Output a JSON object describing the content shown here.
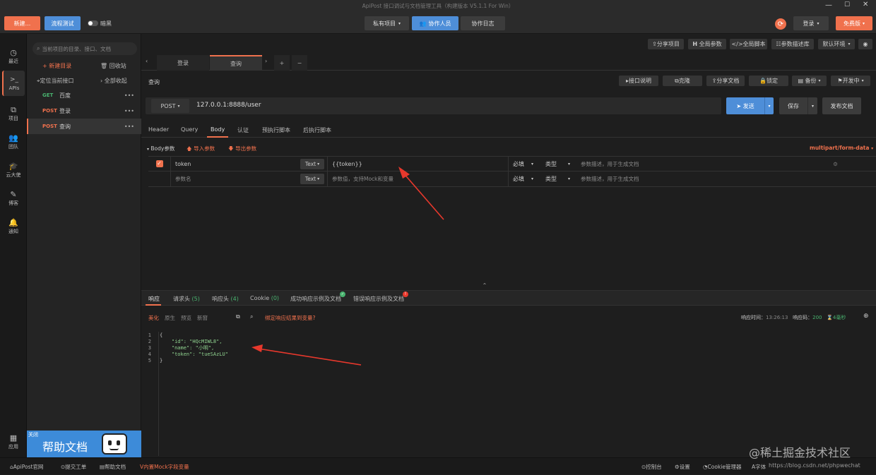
{
  "titlebar": {
    "title": "ApiPost 接口调试与文档管理工具（构建版本 V5.1.1 For Win）",
    "new_button": "新建...",
    "flow_test_button": "流程测试",
    "toggle_label": "暗黑",
    "private_project": "私有项目",
    "collaborators": "协作人员",
    "collab_log": "协作日志",
    "login": "登录",
    "free_version": "免费版"
  },
  "sidebar": {
    "items": [
      {
        "label": "最近",
        "icon": "clock-icon"
      },
      {
        "label": "APIs",
        "icon": "terminal-icon"
      },
      {
        "label": "项目",
        "icon": "project-icon"
      },
      {
        "label": "团队",
        "icon": "team-icon"
      },
      {
        "label": "云大使",
        "icon": "cap-icon"
      },
      {
        "label": "博客",
        "icon": "edit-icon"
      },
      {
        "label": "通知",
        "icon": "bell-icon"
      }
    ],
    "apps_label": "应用"
  },
  "tree": {
    "search_placeholder": "当前项目的目录、接口、文档",
    "new_dir": "新建目录",
    "recycle": "回收站",
    "locate": "定位当前接口",
    "collapse_all": "全部收起",
    "items": [
      {
        "method": "GET",
        "name": "百度"
      },
      {
        "method": "POST",
        "name": "登录"
      },
      {
        "method": "POST",
        "name": "查询"
      }
    ],
    "help_close": "关闭",
    "help_banner": "帮助文档"
  },
  "toolbar": {
    "share_project": "分享项目",
    "global_params": "全局参数",
    "global_script": "全局脚本",
    "param_desc_lib": "参数描述库",
    "default_env": "默认环境"
  },
  "tabs": [
    {
      "label": "登录"
    },
    {
      "label": "查询"
    }
  ],
  "request": {
    "name": "查询",
    "api_doc": "接口说明",
    "clone": "克隆",
    "share_doc": "分享文档",
    "lock": "锁定",
    "backup": "备份",
    "dev_status": "开发中",
    "method": "POST",
    "url": "127.0.0.1:8888/user",
    "send": "发送",
    "save": "保存",
    "publish": "发布文档",
    "subtabs": [
      "Header",
      "Query",
      "Body",
      "认证",
      "预执行脚本",
      "后执行脚本"
    ],
    "active_subtab": "Body",
    "body_params_label": "Body参数",
    "import_params": "导入参数",
    "export_params": "导出参数",
    "content_type": "multipart/form-data",
    "params": [
      {
        "name": "token",
        "type": "Text",
        "value": "{{token}}",
        "required": "必填",
        "kind": "类型",
        "desc_placeholder": "参数描述，用于生成文档"
      }
    ],
    "new_param": {
      "name_placeholder": "参数名",
      "type": "Text",
      "value_placeholder": "参数值，支持Mock和变量",
      "required": "必填",
      "kind": "类型",
      "desc_placeholder": "参数描述，用于生成文档"
    }
  },
  "response": {
    "tabs": [
      {
        "label": "响应"
      },
      {
        "label": "请求头",
        "count": "(5)"
      },
      {
        "label": "响应头",
        "count": "(4)"
      },
      {
        "label": "Cookie",
        "count": "(0)"
      },
      {
        "label": "成功响应示例及文档"
      },
      {
        "label": "错误响应示例及文档"
      }
    ],
    "view_modes": [
      "美化",
      "原生",
      "预览",
      "新窗"
    ],
    "bind_var": "绑定响应结果到变量?",
    "time_label": "响应时间：",
    "time_value": "13:26:13",
    "code_label": "响应码：",
    "code_value": "200",
    "duration": "4毫秒",
    "lines": [
      {
        "no": "1",
        "text": "{"
      },
      {
        "no": "2",
        "text": "    \"id\": \"HQcMIWL8\","
      },
      {
        "no": "3",
        "text": "    \"name\": \"小明\","
      },
      {
        "no": "4",
        "text": "    \"token\": \"tueSAzLU\""
      },
      {
        "no": "5",
        "text": "}"
      }
    ]
  },
  "bottom": {
    "apipost_site": "ApiPost官网",
    "submit_ticket": "提交工单",
    "help_doc": "帮助文档",
    "mock_vars": "内置Mock字段变量",
    "console": "控制台",
    "settings": "设置",
    "cookie_mgr": "Cookie管理器",
    "font_size": "字体",
    "watermark": "@稀土掘金技术社区",
    "url_watermark": "https://blog.csdn.net/phpwechat"
  },
  "colors": {
    "accent": "#f0714d",
    "primary": "#4e8ed8",
    "get": "#49b36f",
    "annotation": "#e8382c"
  }
}
